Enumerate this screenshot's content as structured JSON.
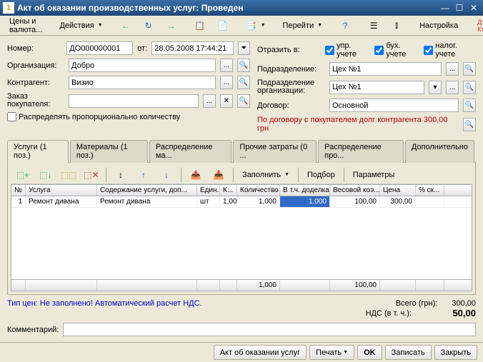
{
  "window": {
    "title": "Акт об оказании производственных услуг: Проведен"
  },
  "toolbar": {
    "prices": "Цены и валюта...",
    "actions": "Действия",
    "goto": "Перейти",
    "settings": "Настройка"
  },
  "form": {
    "number_label": "Номер:",
    "number": "ДО000000001",
    "from_label": "от:",
    "date": "28.05.2008 17:44:21",
    "reflect_label": "Отразить в:",
    "chk_upr": "упр. учете",
    "chk_buh": "бух. учете",
    "chk_nalog": "налог. учете",
    "org_label": "Организация:",
    "org": "Добро",
    "dept_label": "Подразделение:",
    "dept": "Цех №1",
    "contr_label": "Контрагент:",
    "contr": "Визио",
    "dept_org_label": "Подразделение организации:",
    "dept_org": "Цех №1",
    "order_label": "Заказ покупателя:",
    "order": "",
    "dogovor_label": "Договор:",
    "dogovor": "Основной",
    "prop_label": "Распределять пропорционально количеству",
    "debt_text": "По договору с покупателем долг контрагента 300,00 грн"
  },
  "tabs": [
    "Услуги (1 поз.)",
    "Материалы (1 поз.)",
    "Распределение ма...",
    "Прочие затраты (0 ...",
    "Распределение про...",
    "Дополнительно"
  ],
  "grid_toolbar": {
    "fill": "Заполнить",
    "select": "Подбор",
    "params": "Параметры"
  },
  "grid": {
    "cols": [
      "№",
      "Услуга",
      "Содержание услуги, доп...",
      "Един...",
      "К...",
      "Количество",
      "В т.ч. доделка",
      "Весовой коэ...",
      "Цена",
      "% ск..."
    ],
    "widths": [
      20,
      100,
      140,
      32,
      24,
      60,
      70,
      70,
      50,
      40
    ],
    "rows": [
      {
        "n": "1",
        "service": "Ремонт дивана",
        "content": "Ремонт дивана",
        "unit": "шт",
        "k": "1,000",
        "qty": "1,000",
        "rework": "1,000",
        "weight": "100,00",
        "price": "300,00",
        "disc": ""
      }
    ],
    "foot": {
      "qty": "1,000",
      "weight": "100,00"
    }
  },
  "price_info": "Тип цен: Не заполнено! Автоматический расчет НДС.",
  "totals": {
    "total_label": "Всего (грн):",
    "total": "300,00",
    "vat_label": "НДС (в т. ч.):",
    "vat": "50,00"
  },
  "comment_label": "Комментарий:",
  "comment": "",
  "bottom": {
    "act": "Акт об оказании услуг",
    "print": "Печать",
    "ok": "OK",
    "save": "Записать",
    "close": "Закрыть"
  }
}
